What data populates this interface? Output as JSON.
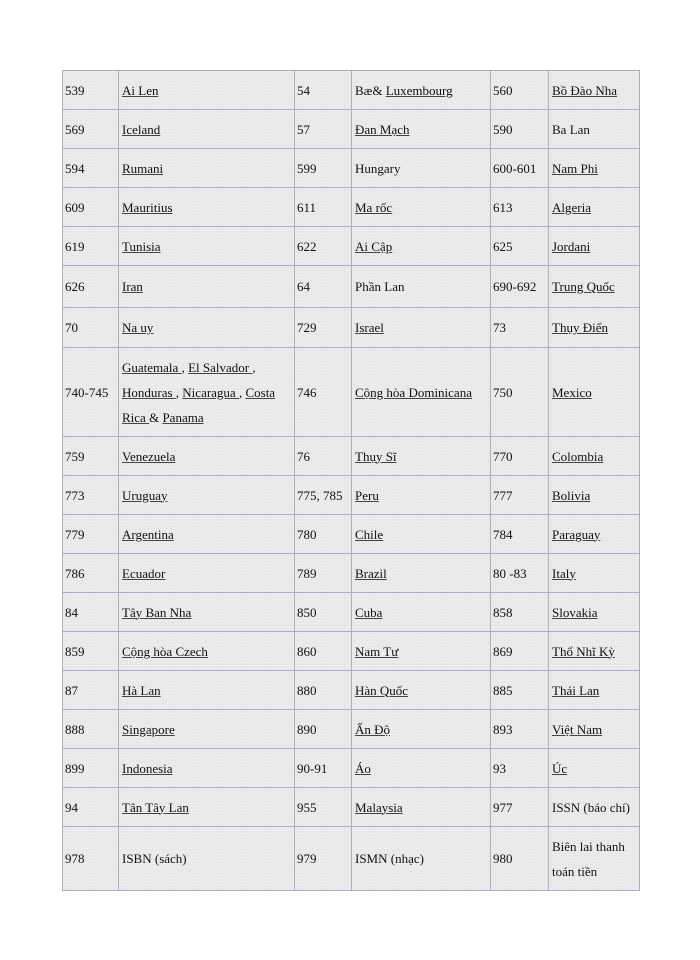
{
  "table": {
    "rows": [
      [
        [
          "539",
          [
            [
              "Ai Len ",
              true
            ]
          ]
        ],
        [
          "54",
          [
            [
              " Bæ& ",
              false
            ],
            [
              "Luxembourg ",
              true
            ]
          ]
        ],
        [
          "560",
          [
            [
              "Bồ Đào Nha ",
              true
            ]
          ]
        ]
      ],
      [
        [
          "569",
          [
            [
              "Iceland ",
              true
            ]
          ]
        ],
        [
          "57",
          [
            [
              "Đan Mạch",
              true
            ]
          ]
        ],
        [
          "590",
          [
            [
              "Ba Lan",
              false
            ]
          ]
        ]
      ],
      [
        [
          "594",
          [
            [
              "Rumani ",
              true
            ]
          ]
        ],
        [
          "599",
          [
            [
              "Hungary",
              false
            ]
          ]
        ],
        [
          "600-601",
          [
            [
              "Nam Phi",
              true
            ]
          ]
        ]
      ],
      [
        [
          "609",
          [
            [
              "Mauritius ",
              true
            ]
          ]
        ],
        [
          "611",
          [
            [
              "Ma rốc",
              true
            ]
          ]
        ],
        [
          "613",
          [
            [
              "Algeria ",
              true
            ]
          ]
        ]
      ],
      [
        [
          "619",
          [
            [
              "Tunisia ",
              true
            ]
          ]
        ],
        [
          "622",
          [
            [
              "Ai Cập",
              true
            ]
          ]
        ],
        [
          "625",
          [
            [
              "Jordani ",
              true
            ]
          ]
        ]
      ],
      [
        [
          "626",
          [
            [
              "Iran ",
              true
            ]
          ]
        ],
        [
          "64",
          [
            [
              "Phần Lan",
              false
            ]
          ]
        ],
        [
          "690-692",
          [
            [
              "Trung  Quốc",
              true
            ]
          ]
        ]
      ],
      [
        [
          "70",
          [
            [
              "Na uy ",
              true
            ]
          ]
        ],
        [
          "729",
          [
            [
              "Israel ",
              true
            ]
          ]
        ],
        [
          "73",
          [
            [
              "Thụy  Điển",
              true
            ]
          ]
        ]
      ],
      [
        [
          "740-745",
          [
            [
              "Guatemala ",
              true
            ],
            [
              ", ",
              false
            ],
            [
              "El Salvador ",
              true
            ],
            [
              ", ",
              false
            ],
            [
              "Honduras ",
              true
            ],
            [
              ", ",
              false
            ],
            [
              "Nicaragua ",
              true
            ],
            [
              ", ",
              false
            ],
            [
              "Costa Rica ",
              true
            ],
            [
              " & ",
              false
            ],
            [
              "Panama ",
              true
            ]
          ]
        ],
        [
          "746",
          [
            [
              "Cộng hòa Dominicana ",
              true
            ]
          ]
        ],
        [
          "750",
          [
            [
              "Mexico ",
              true
            ]
          ]
        ]
      ],
      [
        [
          "759",
          [
            [
              "Venezuela ",
              true
            ]
          ]
        ],
        [
          "76",
          [
            [
              "Thụy  Sĩ",
              true
            ]
          ]
        ],
        [
          "770",
          [
            [
              "Colombia ",
              true
            ]
          ]
        ]
      ],
      [
        [
          "773",
          [
            [
              "Uruguay ",
              true
            ]
          ]
        ],
        [
          "775, 785",
          [
            [
              "Peru ",
              true
            ]
          ]
        ],
        [
          "777",
          [
            [
              "Bolivia ",
              true
            ]
          ]
        ]
      ],
      [
        [
          "779",
          [
            [
              "Argentina ",
              true
            ]
          ]
        ],
        [
          "780",
          [
            [
              "Chile ",
              true
            ]
          ]
        ],
        [
          "784",
          [
            [
              "Paraguay ",
              true
            ]
          ]
        ]
      ],
      [
        [
          "786",
          [
            [
              "Ecuador ",
              true
            ]
          ]
        ],
        [
          "789",
          [
            [
              "Brazil ",
              true
            ]
          ]
        ],
        [
          "80 -83",
          [
            [
              "Italy ",
              true
            ]
          ]
        ]
      ],
      [
        [
          "84",
          [
            [
              "Tây Ban Nha",
              true
            ]
          ]
        ],
        [
          "850",
          [
            [
              "Cuba ",
              true
            ]
          ]
        ],
        [
          "858",
          [
            [
              "Slovakia ",
              true
            ]
          ]
        ]
      ],
      [
        [
          "859",
          [
            [
              "Cộng hòa Czech",
              true
            ]
          ]
        ],
        [
          "860",
          [
            [
              "Nam Tư",
              true
            ]
          ]
        ],
        [
          "869",
          [
            [
              "Thổ Nhĩ Kỳ",
              true
            ]
          ]
        ]
      ],
      [
        [
          "87",
          [
            [
              "Hà Lan",
              true
            ]
          ]
        ],
        [
          "880",
          [
            [
              "Hàn Quốc",
              true
            ]
          ]
        ],
        [
          "885",
          [
            [
              "Thái  Lan",
              true
            ]
          ]
        ]
      ],
      [
        [
          "888",
          [
            [
              "Singapore ",
              true
            ]
          ]
        ],
        [
          "890",
          [
            [
              "Ấn Độ",
              true
            ]
          ]
        ],
        [
          "893",
          [
            [
              "Việt  Nam",
              true
            ]
          ]
        ]
      ],
      [
        [
          "899",
          [
            [
              "Indonesia ",
              true
            ]
          ]
        ],
        [
          "90-91",
          [
            [
              "Áo",
              true
            ]
          ]
        ],
        [
          "93",
          [
            [
              "Úc",
              true
            ]
          ]
        ]
      ],
      [
        [
          "94",
          [
            [
              "Tân Tây Lan",
              true
            ]
          ]
        ],
        [
          "955",
          [
            [
              "Malaysia ",
              true
            ]
          ]
        ],
        [
          "977",
          [
            [
              "ISSN (báo chí)",
              false
            ]
          ]
        ]
      ],
      [
        [
          "978",
          [
            [
              "ISBN (sách)",
              false
            ]
          ]
        ],
        [
          "979",
          [
            [
              "ISMN (nhạc)",
              false
            ]
          ]
        ],
        [
          "980",
          [
            [
              "Biên lai thanh toán tiền",
              false
            ]
          ]
        ]
      ]
    ]
  }
}
